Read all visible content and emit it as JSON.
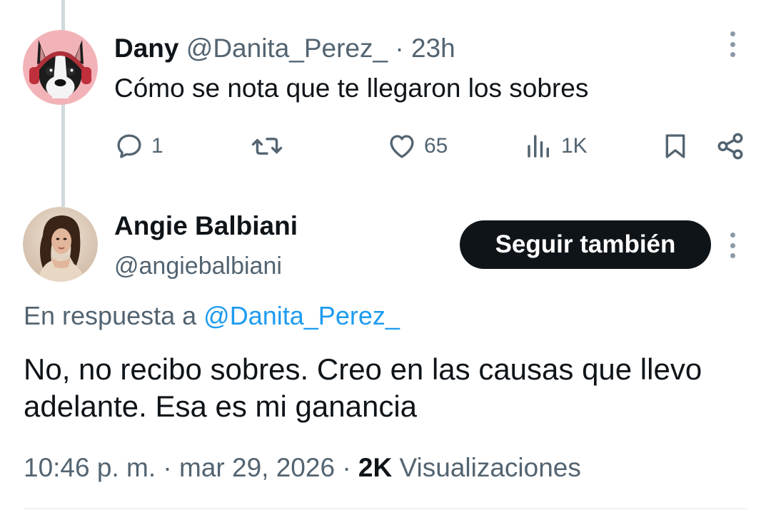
{
  "reply_tweet": {
    "display_name": "Dany",
    "handle": "@Danita_Perez_",
    "separator": "·",
    "time": "23h",
    "text": "Cómo se nota que te llegaron los sobres",
    "actions": {
      "replies": "1",
      "likes": "65",
      "views": "1K"
    },
    "avatar_icon": "dog-with-headphones-avatar"
  },
  "main_tweet": {
    "display_name": "Angie Balbiani",
    "handle": "@angiebalbiani",
    "follow_label": "Seguir también",
    "reply_prefix": "En respuesta a",
    "reply_mention": "@Danita_Perez_",
    "text": "No, no recibo sobres. Creo en las causas que llevo adelante. Esa es mi ganancia",
    "time": "10:46 p. m.",
    "sep1": "·",
    "date": "mar 29, 2026",
    "sep2": "·",
    "views_count": "2K",
    "views_label": "Visualizaciones",
    "avatar_icon": "woman-portrait-avatar"
  },
  "colors": {
    "text_primary": "#0f1419",
    "text_muted": "#536471",
    "link": "#1d9bf0",
    "button_bg": "#0f1419",
    "thread_line": "#cfd9de"
  }
}
